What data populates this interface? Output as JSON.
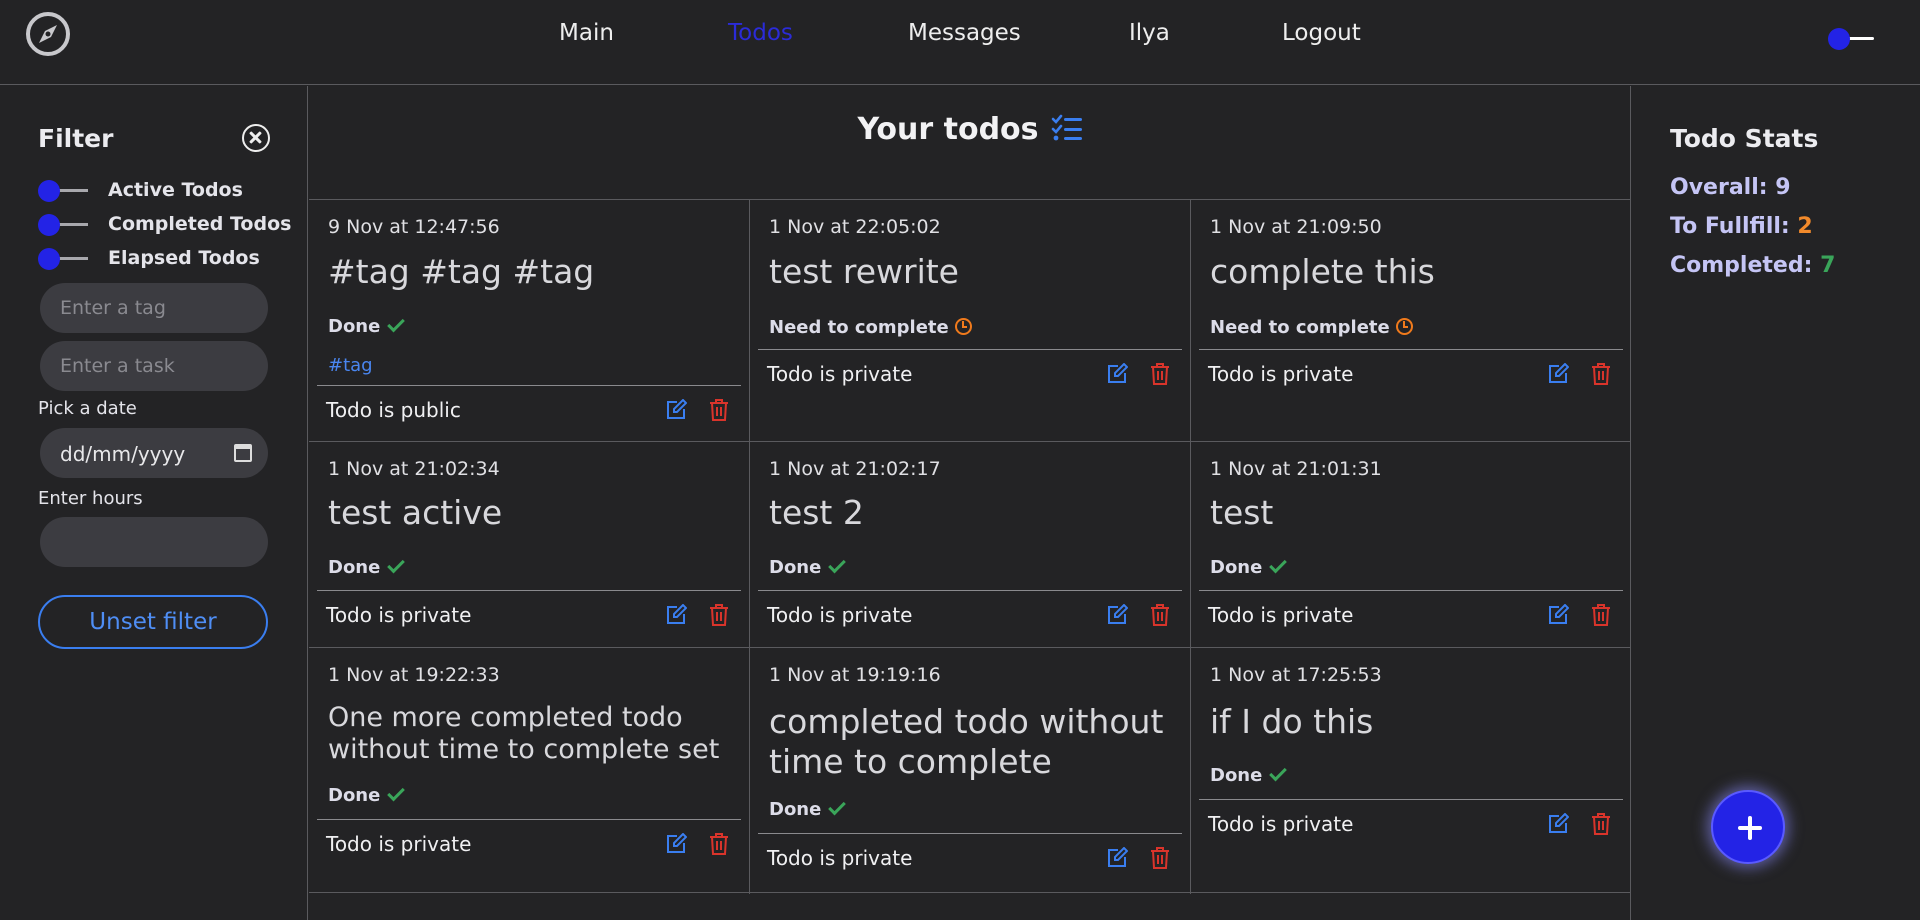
{
  "nav": {
    "items": [
      {
        "label": "Main",
        "active": false
      },
      {
        "label": "Todos",
        "active": true
      },
      {
        "label": "Messages",
        "active": false
      },
      {
        "label": "Ilya",
        "active": false
      },
      {
        "label": "Logout",
        "active": false
      }
    ]
  },
  "filter": {
    "title": "Filter",
    "switches": [
      "Active Todos",
      "Completed Todos",
      "Elapsed Todos"
    ],
    "tag_placeholder": "Enter a tag",
    "task_placeholder": "Enter a task",
    "date_label": "Pick a date",
    "date_value": "dd/mm/yyyy",
    "hours_label": "Enter hours",
    "unset_label": "Unset filter"
  },
  "main": {
    "title": "Your todos",
    "todos": [
      {
        "date": "9 Nov at 12:47:56",
        "title": "#tag #tag #tag",
        "status": "Done",
        "tag": "#tag",
        "privacy": "Todo is public"
      },
      {
        "date": "1 Nov at 22:05:02",
        "title": "test rewrite",
        "status": "Need to complete",
        "privacy": "Todo is private"
      },
      {
        "date": "1 Nov at 21:09:50",
        "title": "complete this",
        "status": "Need to complete",
        "privacy": "Todo is private"
      },
      {
        "date": "1 Nov at 21:02:34",
        "title": "test active",
        "status": "Done",
        "privacy": "Todo is private"
      },
      {
        "date": "1 Nov at 21:02:17",
        "title": "test 2",
        "status": "Done",
        "privacy": "Todo is private"
      },
      {
        "date": "1 Nov at 21:01:31",
        "title": "test",
        "status": "Done",
        "privacy": "Todo is private"
      },
      {
        "date": "1 Nov at 19:22:33",
        "title": "One more completed todo without time to complete set",
        "status": "Done",
        "privacy": "Todo is private"
      },
      {
        "date": "1 Nov at 19:19:16",
        "title": "completed todo without time to complete",
        "status": "Done",
        "privacy": "Todo is private"
      },
      {
        "date": "1 Nov at 17:25:53",
        "title": "if I do this",
        "status": "Done",
        "privacy": "Todo is private"
      }
    ]
  },
  "stats": {
    "title": "Todo Stats",
    "overall_label": "Overall:",
    "overall_value": "9",
    "fulfill_label": "To Fullfill:",
    "fulfill_value": "2",
    "completed_label": "Completed:",
    "completed_value": "7"
  },
  "colors": {
    "accent": "#2323e6",
    "link_blue": "#4a86f0",
    "done_green": "#3aa55a",
    "pending_orange": "#f07a1c",
    "delete_red": "#d9342b"
  },
  "icons": {
    "logo": "compass-icon",
    "title": "checklist-icon",
    "edit": "edit-icon",
    "delete": "trash-icon",
    "close": "close-circle-icon",
    "calendar": "calendar-icon",
    "add": "plus-icon"
  }
}
